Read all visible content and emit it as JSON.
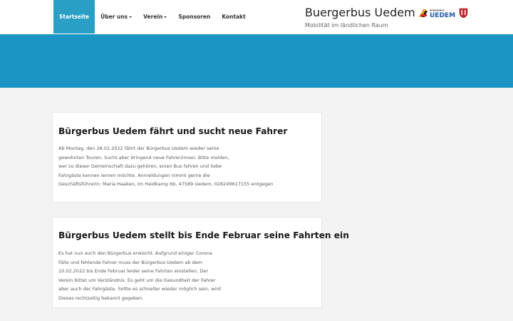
{
  "nav": {
    "items": [
      {
        "label": "Startseite",
        "active": true,
        "dropdown": false
      },
      {
        "label": "Über uns",
        "active": false,
        "dropdown": true
      },
      {
        "label": "Verein",
        "active": false,
        "dropdown": true
      },
      {
        "label": "Sponsoren",
        "active": false,
        "dropdown": false
      },
      {
        "label": "Kontakt",
        "active": false,
        "dropdown": false
      }
    ]
  },
  "brand": {
    "title": "Buergerbus Uedem",
    "subtitle": "Mobilität im ländlichen Raum",
    "logo_text": "UEDEM",
    "logo_small_text": "BÜRGERBUS"
  },
  "colors": {
    "accent": "#2a9fc5",
    "hero": "#1b95c3",
    "background": "#f3f3f3"
  },
  "posts": [
    {
      "title": "Bürgerbus Uedem fährt und sucht neue Fahrer",
      "lines": [
        "Ab Montag, den 28.02.2022 fährt der Bürgerbus Uedem wieder seine",
        "gewohnten Touren. Sucht aber dringend neue Fahrer/innen. Bitte melden,",
        "wer zu dieser Gemeinschaft dazu gehören, einen Bus fahren und liebe",
        "Fahrgäste kennen lernen möchte. Anmeldungen nimmt gerne die",
        "Geschäftsführerin: Maria Haaken, Im Heidkamp 6b, 47589 Uedem, 028249617155 entgegen"
      ]
    },
    {
      "title": "Bürgerbus Uedem stellt bis Ende Februar seine Fahrten ein",
      "lines": [
        "Es hat nun auch den Bürgerbus erwischt. Aufgrund einiger Corona",
        "Fälle und fehlende Fahrer muss der Bürgerbus Uedem ab dem",
        "10.02.2022 bis Ende Februar leider seine Fahrten einstellen. Der",
        "Verein bittet um Verständnis. Es geht um die Gesundheit der Fahrer",
        "aber auch der Fahrgäste. Sollte es schneller wieder möglich sein, wird",
        "Dieses rechtzeitig bekannt gegeben."
      ]
    }
  ]
}
